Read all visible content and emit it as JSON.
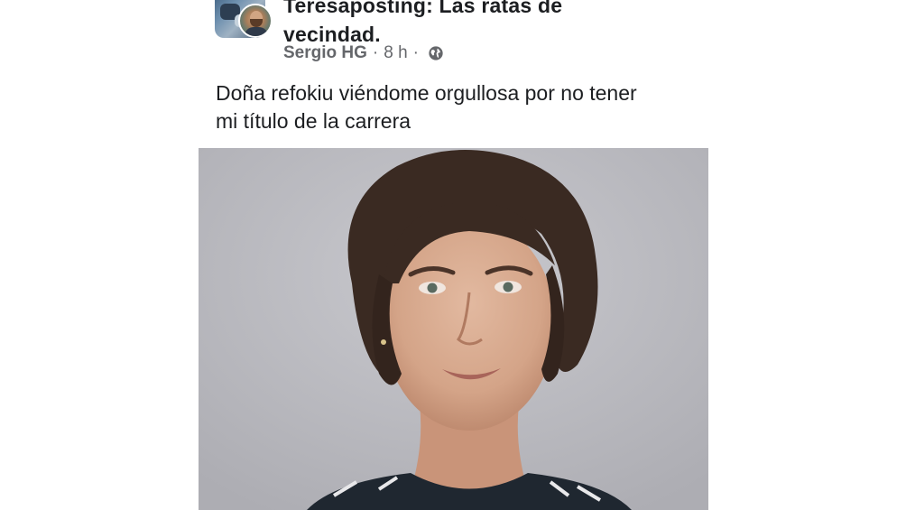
{
  "group": {
    "title_line1": "Teresaposting: Las ratas de",
    "title_line2": "vecindad."
  },
  "post": {
    "author": "Sergio HG",
    "separator": "·",
    "time": "8 h",
    "privacy_icon": "globe-icon",
    "text_line1": "Doña refokiu viéndome orgullosa por no tener",
    "text_line2": "mi título de la carrera",
    "photo_icon": "portrait-photo"
  },
  "colors": {
    "text_primary": "#1c1e21",
    "text_secondary": "#65676b",
    "background": "#ffffff",
    "photo_background": "#bdbdc2"
  }
}
